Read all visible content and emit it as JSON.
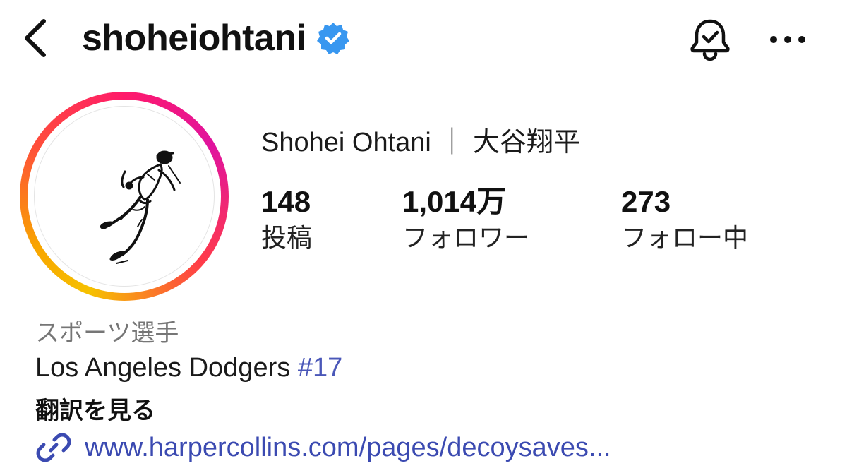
{
  "header": {
    "username": "shoheiohtani",
    "verified": true
  },
  "profile": {
    "full_name": "Shohei Ohtani ｜ 大谷翔平",
    "stats": {
      "posts": {
        "value": "148",
        "label": "投稿"
      },
      "followers": {
        "value": "1,014万",
        "label": "フォロワー"
      },
      "following": {
        "value": "273",
        "label": "フォロー中"
      }
    },
    "category": "スポーツ選手",
    "bio_text": "Los Angeles Dodgers ",
    "bio_hashtag": "#17",
    "translate_label": "翻訳を見る",
    "link": "www.harpercollins.com/pages/decoysaves..."
  },
  "colors": {
    "verified_blue": "#3897f0",
    "link_blue": "#3b4ab1",
    "hashtag_blue": "#4a57b8",
    "category_gray": "#767676"
  },
  "icons": {
    "back": "chevron-left-icon",
    "verified": "verified-badge-icon",
    "notifications": "bell-check-icon",
    "more": "more-horizontal-icon",
    "link": "link-icon"
  }
}
